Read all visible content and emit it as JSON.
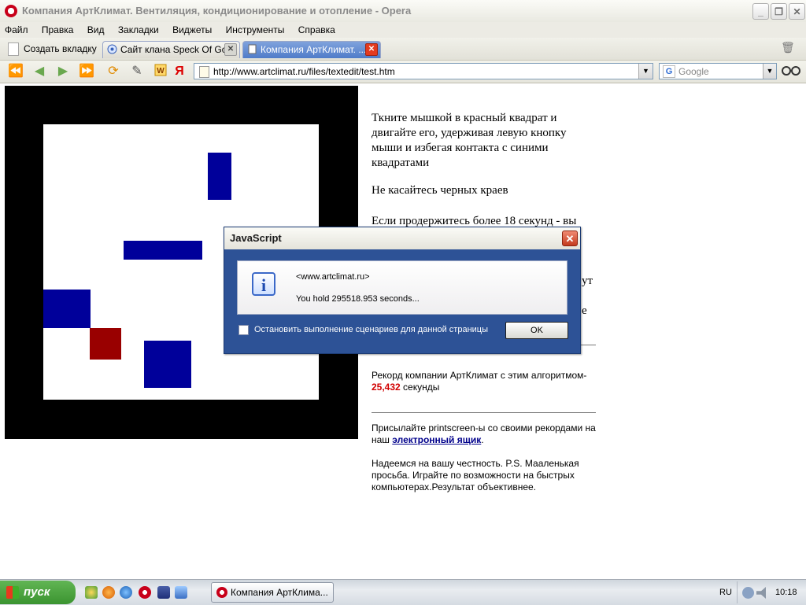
{
  "window": {
    "title": "Компания АртКлимат. Вентиляция, кондиционирование и отопление - Opera",
    "minimize_glyph": "_",
    "restore_glyph": "❐",
    "close_glyph": "✕"
  },
  "menu": [
    "Файл",
    "Правка",
    "Вид",
    "Закладки",
    "Виджеты",
    "Инструменты",
    "Справка"
  ],
  "tabs": {
    "new_tab_label": "Создать вкладку",
    "items": [
      {
        "label": "Сайт клана Speck Of Gold",
        "active": false
      },
      {
        "label": "Компания АртКлимат. ...",
        "active": true
      }
    ]
  },
  "address": {
    "url": "http://www.artclimat.ru/files/textedit/test.htm",
    "search_placeholder": "Google",
    "search_logo": "G"
  },
  "page": {
    "instructions": "Ткните мышкой в красный квадрат и двигайте его, удерживая левую кнопку мыши и избегая контакта с синими квадратами",
    "no_touch": "Не касайтесь черных краев",
    "intro_partial": "Если продержитесь более 18 секунд - вы",
    "partial_1": "ут",
    "partial_2": "е",
    "record_text": "Рекорд компании АртКлимат с этим алгоритмом-",
    "record_value": "25,432",
    "record_unit": "секунды",
    "send_text": "Присылайте printscreen-ы со своими рекордами на наш",
    "email_link": "электронный ящик",
    "period": ".",
    "final_text": "Надеемся на вашу честность. P.S. Мааленькая просьба. Играйте по возможности на быстрых компьютерах.Результат объективнее."
  },
  "dialog": {
    "title": "JavaScript",
    "origin": "<www.artclimat.ru>",
    "message": "You hold 295518.953 seconds...",
    "checkbox_label": "Остановить выполнение сценариев для данной страницы",
    "ok_label": "OK",
    "info_glyph": "i",
    "close_glyph": "✕"
  },
  "taskbar": {
    "start_label": "пуск",
    "task_label": "Компания АртКлима...",
    "lang": "RU",
    "clock": "10:18"
  },
  "colors": {
    "blue_block": "#00009a",
    "red_block": "#990000",
    "record_red": "#d10000"
  }
}
